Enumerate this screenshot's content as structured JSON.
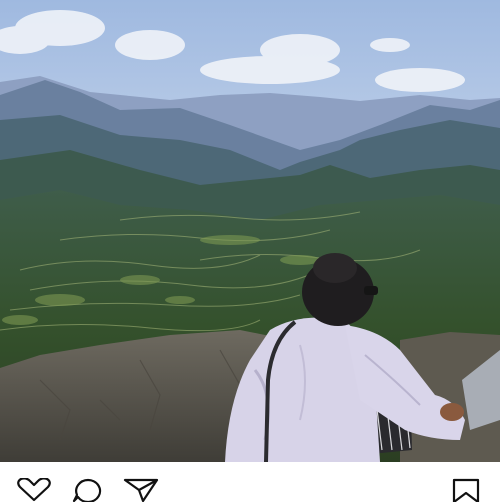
{
  "post": {
    "image": {
      "alt": "",
      "colors": {
        "sky_top": "#a9c3e6",
        "sky_bottom": "#e9eef5",
        "far_mountains": "#7f93b8",
        "mid_mountains": "#4c6a78",
        "valley": "#3c5a36",
        "rock": "#5b5a52",
        "hoodie": "#dcd8ea"
      }
    },
    "actions": [
      {
        "name": "like",
        "icon": "heart-outline"
      },
      {
        "name": "comment",
        "icon": "speech-bubble-outline"
      },
      {
        "name": "share",
        "icon": "paper-plane-outline"
      },
      {
        "name": "save",
        "icon": "bookmark-outline"
      }
    ]
  }
}
